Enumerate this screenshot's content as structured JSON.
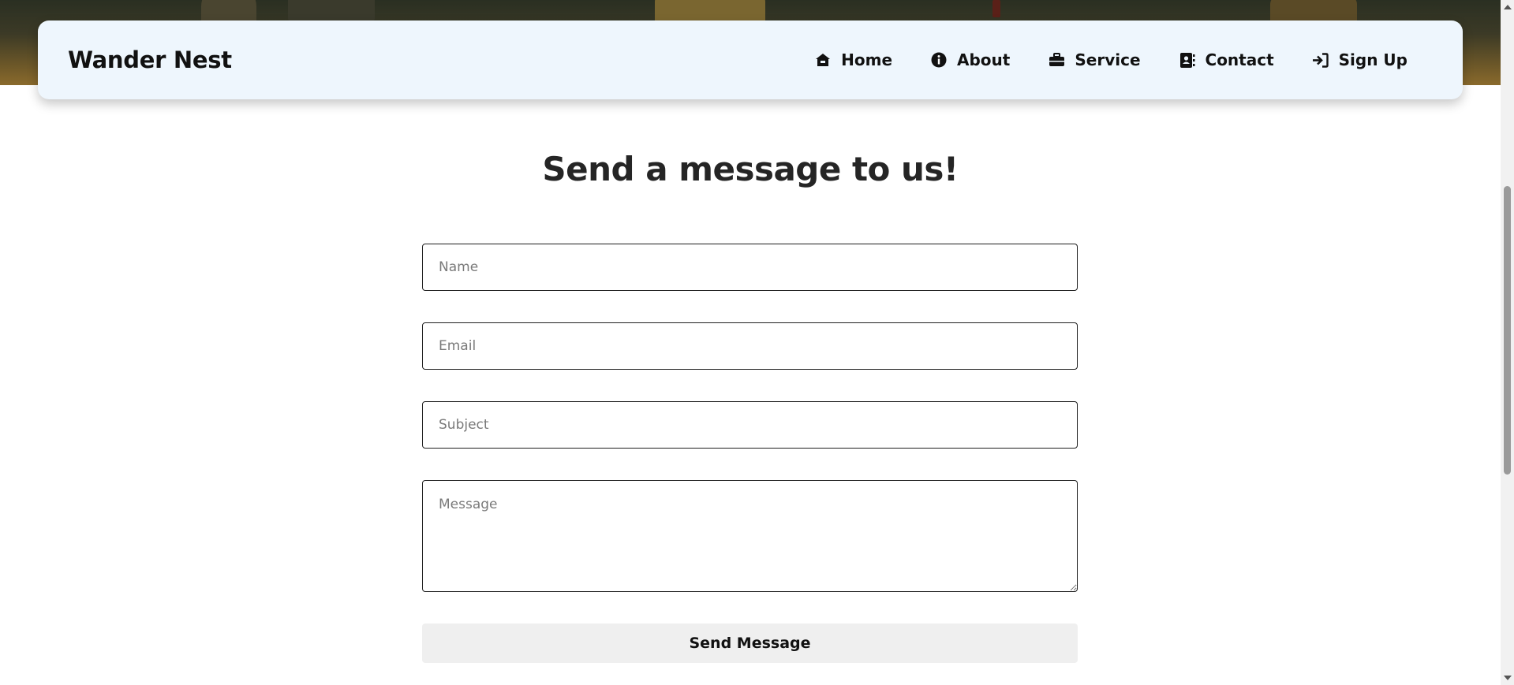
{
  "brand": "Wander Nest",
  "nav": {
    "items": [
      {
        "label": "Home",
        "icon": "home-icon"
      },
      {
        "label": "About",
        "icon": "info-icon"
      },
      {
        "label": "Service",
        "icon": "briefcase-icon"
      },
      {
        "label": "Contact",
        "icon": "contact-book-icon"
      },
      {
        "label": "Sign Up",
        "icon": "sign-in-icon"
      }
    ]
  },
  "contact_form": {
    "heading": "Send a message to us!",
    "name_placeholder": "Name",
    "name_value": "",
    "email_placeholder": "Email",
    "email_value": "",
    "subject_placeholder": "Subject",
    "subject_value": "",
    "message_placeholder": "Message",
    "message_value": "",
    "submit_label": "Send Message"
  },
  "colors": {
    "navbar_bg": "#eef6fd",
    "button_bg": "#efefef",
    "text": "#111111"
  }
}
